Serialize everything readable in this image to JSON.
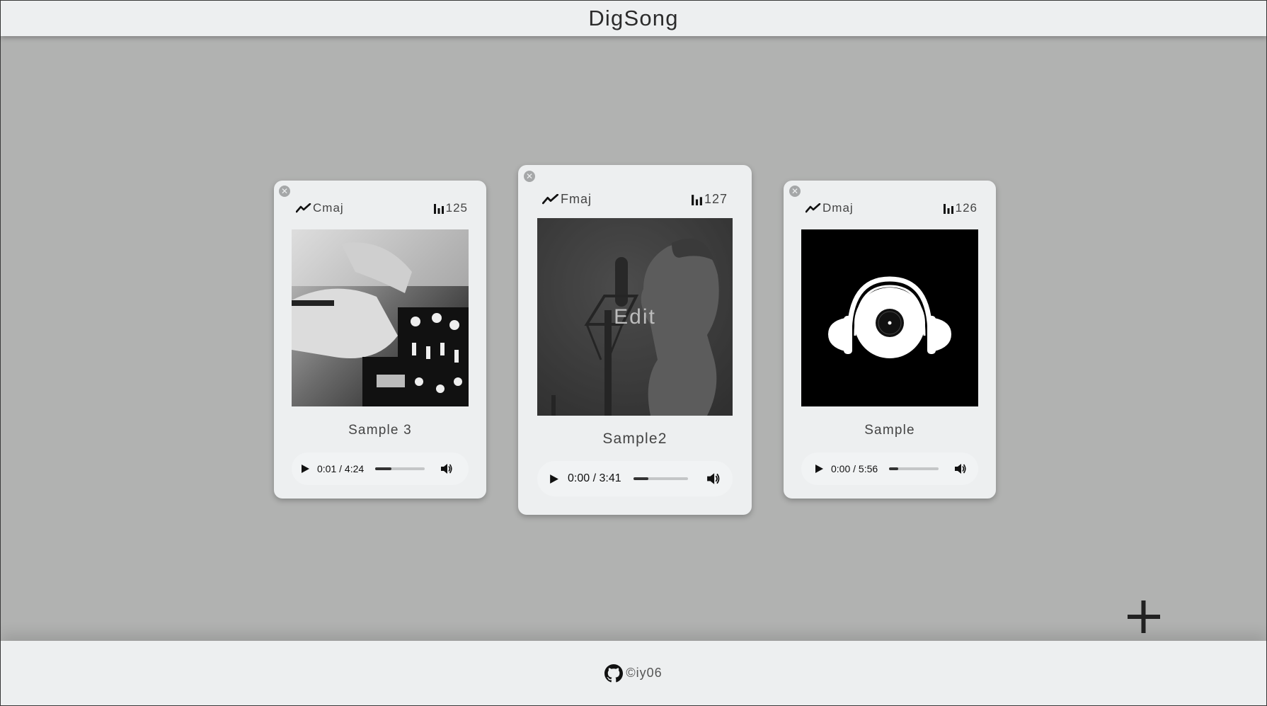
{
  "app": {
    "title": "DigSong"
  },
  "cards": [
    {
      "key": "Cmaj",
      "bpm": "125",
      "name": "Sample 3",
      "art": "dj-mixer-photo",
      "player": {
        "time": "0:01 / 4:24",
        "progress": 0.32
      }
    },
    {
      "key": "Fmaj",
      "bpm": "127",
      "name": "Sample2",
      "art": "singer-microphone-photo",
      "overlay_label": "Edit",
      "player": {
        "time": "0:00 / 3:41",
        "progress": 0.28
      }
    },
    {
      "key": "Dmaj",
      "bpm": "126",
      "name": "Sample",
      "art": "vinyl-headphones-logo",
      "player": {
        "time": "0:00 / 5:56",
        "progress": 0.18
      }
    }
  ],
  "footer": {
    "credit": "©iy06",
    "icon": "github-icon"
  },
  "add": {
    "icon": "plus-icon"
  },
  "colors": {
    "background": "#b1b2b1",
    "surface": "#edeff0",
    "text": "#444444"
  }
}
